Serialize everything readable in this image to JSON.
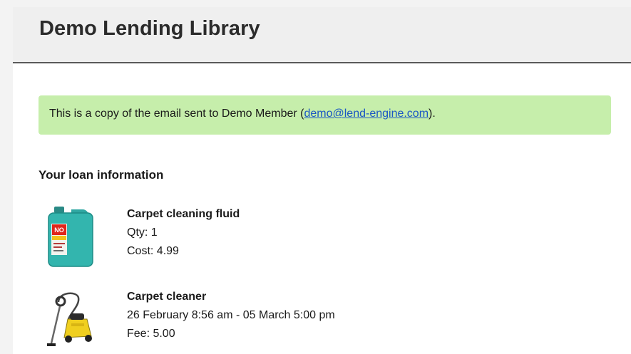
{
  "header": {
    "title": "Demo Lending Library"
  },
  "notice": {
    "text_before": "This is a copy of the email sent to Demo Member (",
    "email": "demo@lend-engine.com",
    "text_after": ")."
  },
  "loan_section": {
    "title": "Your loan information"
  },
  "items": [
    {
      "name": "Carpet cleaning fluid",
      "line1": "Qty: 1",
      "line2": "Cost: 4.99",
      "icon": "cleaning-fluid-bottle-icon"
    },
    {
      "name": "Carpet cleaner",
      "line1": "26 February 8:56 am - 05 March 5:00 pm",
      "line2": "Fee: 5.00",
      "icon": "carpet-cleaner-machine-icon"
    }
  ],
  "colors": {
    "notice_bg": "#c6eeab",
    "link": "#1a56c4",
    "header_bg": "#efefef"
  }
}
